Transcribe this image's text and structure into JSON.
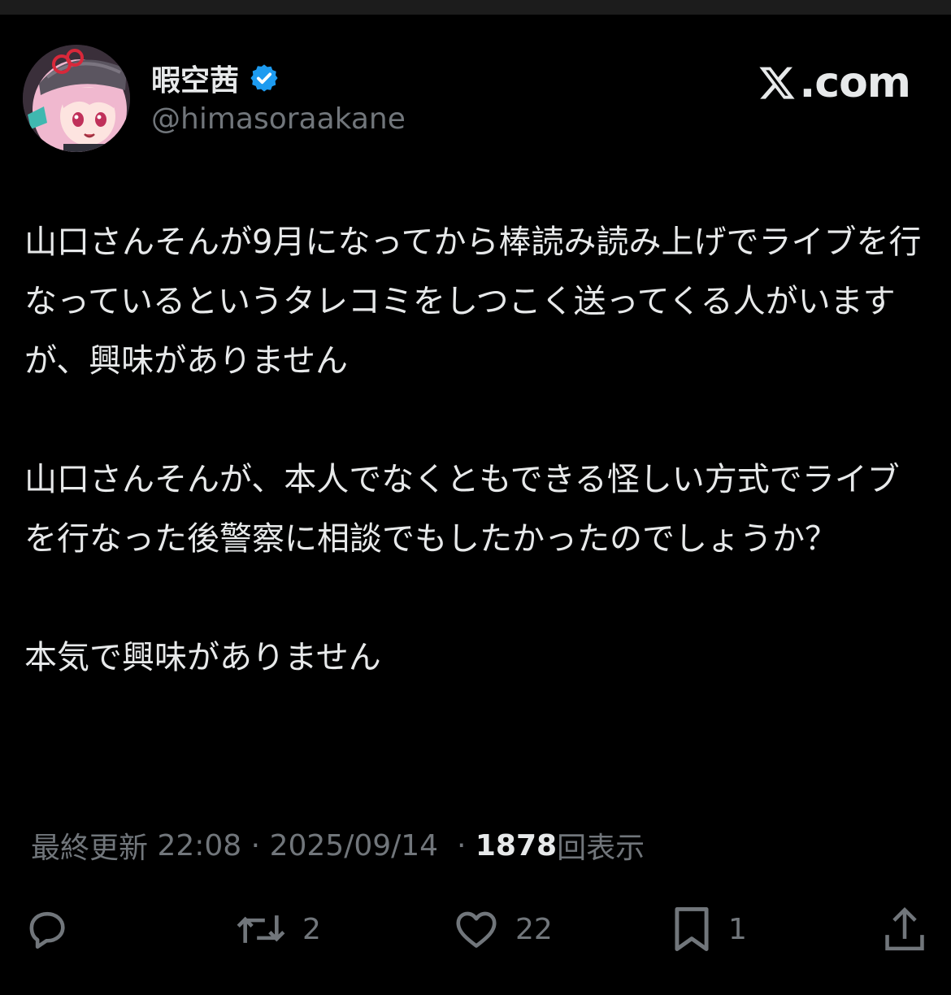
{
  "author": {
    "display_name": "暇空茜",
    "handle": "@himasoraakane",
    "verified": true,
    "avatar": "anime-girl-avatar"
  },
  "brand": {
    "icon": "x-logo-icon",
    "text": ".com"
  },
  "tweet": {
    "paragraphs": [
      "山口さんそんが9月になってから棒読み読み上げでライブを行なっているというタレコミをしつこく送ってくる人がいますが、興味がありません",
      "山口さんそんが、本人でなくともできる怪しい方式でライブを行なった後警察に相談でもしたかったのでしょうか？",
      "本気で興味がありません"
    ]
  },
  "meta": {
    "label": "最終更新",
    "time": "22:08",
    "date": "2025/09/14",
    "separator": "·",
    "views_count": "1878",
    "views_label": "回表示"
  },
  "actions": {
    "reply": {
      "icon": "reply-icon",
      "count": ""
    },
    "repost": {
      "icon": "repost-icon",
      "count": "2"
    },
    "like": {
      "icon": "heart-icon",
      "count": "22"
    },
    "bookmark": {
      "icon": "bookmark-icon",
      "count": "1"
    },
    "share": {
      "icon": "share-icon"
    }
  },
  "colors": {
    "background": "#000000",
    "text": "#e7e9ea",
    "secondary": "#71767b",
    "verified": "#1d9bf0"
  }
}
